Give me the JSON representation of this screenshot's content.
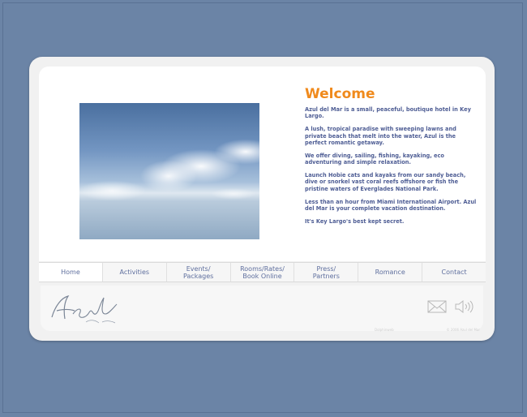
{
  "welcome": {
    "title": "Welcome",
    "paragraphs": [
      "Azul del Mar is a small, peaceful, boutique hotel in Key Largo.",
      "A lush, tropical paradise with sweeping lawns and private beach that melt into the water, Azul is the perfect romantic getaway.",
      "We offer diving, sailing, fishing, kayaking, eco adventuring and simple relaxation.",
      "Launch Hobie cats and kayaks from our sandy beach, dive or snorkel vast coral reefs offshore or fish the pristine waters of Everglades National Park.",
      "Less than an hour from Miami International Airport. Azul del Mar is your complete vacation destination.",
      "It's Key Largo's best kept secret."
    ]
  },
  "nav": {
    "items": [
      {
        "label": "Home"
      },
      {
        "label": "Activities"
      },
      {
        "label": "Events/\nPackages"
      },
      {
        "label": "Rooms/Rates/\nBook Online"
      },
      {
        "label": "Press/\nPartners"
      },
      {
        "label": "Romance"
      },
      {
        "label": "Contact"
      }
    ],
    "active_index": 0
  },
  "logo": {
    "name": "Azul",
    "subtitle": "del Mar"
  },
  "icons": {
    "mail": "mail-icon",
    "sound": "sound-icon"
  },
  "footer": {
    "credit_left": "Dolphinweb",
    "credit_right": "© 2006 Azul del Mar"
  },
  "colors": {
    "background": "#6b84a6",
    "title": "#f08a1c",
    "body_text": "#4e5d94",
    "nav_text": "#5f6f9e"
  }
}
